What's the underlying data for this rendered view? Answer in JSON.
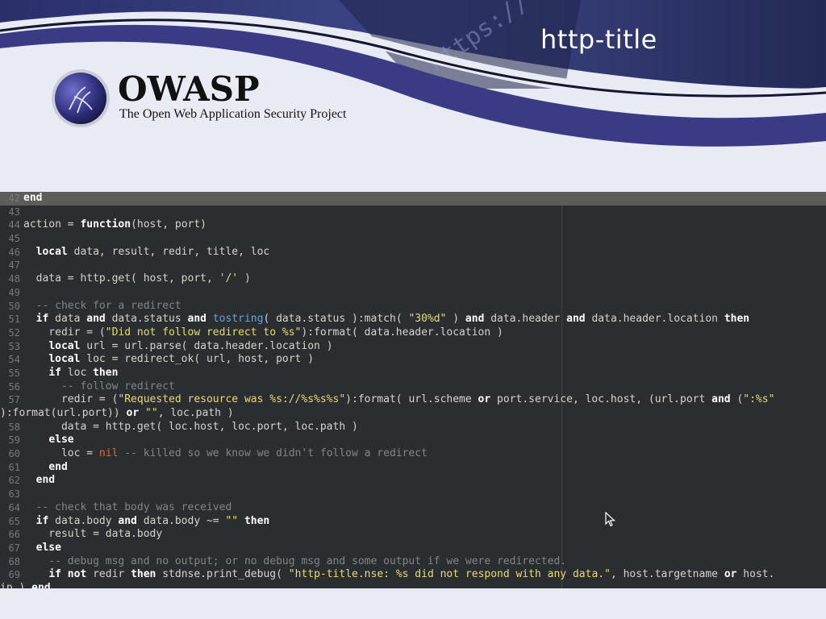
{
  "slide": {
    "title": "http-title"
  },
  "logo": {
    "name": "OWASP",
    "tagline": "The Open Web Application Security Project",
    "banner_text": "https://"
  },
  "colors": {
    "banner": "#3b3a85",
    "code_bg": "#2b2e31",
    "keyword": "#ffffff",
    "string": "#e6db74",
    "comment": "#80848a",
    "builtin": "#66a3d8",
    "nil": "#e66a1a"
  },
  "code": {
    "current_line": 42,
    "lines": [
      {
        "n": "42",
        "t": [
          [
            "k",
            "end"
          ]
        ]
      },
      {
        "n": "43",
        "t": []
      },
      {
        "n": "44",
        "t": [
          [
            "p",
            "action = "
          ],
          [
            "k",
            "function"
          ],
          [
            "p",
            "(host, port)"
          ]
        ]
      },
      {
        "n": "45",
        "t": []
      },
      {
        "n": "46",
        "t": [
          [
            "p",
            "  "
          ],
          [
            "k",
            "local"
          ],
          [
            "p",
            " data, result, redir, title, loc"
          ]
        ]
      },
      {
        "n": "47",
        "t": []
      },
      {
        "n": "48",
        "t": [
          [
            "p",
            "  data = http.get( host, port, "
          ],
          [
            "s",
            "'/'"
          ],
          [
            "p",
            " )"
          ]
        ]
      },
      {
        "n": "49",
        "t": []
      },
      {
        "n": "50",
        "t": [
          [
            "p",
            "  "
          ],
          [
            "c",
            "-- check for a redirect"
          ]
        ]
      },
      {
        "n": "51",
        "t": [
          [
            "p",
            "  "
          ],
          [
            "k",
            "if"
          ],
          [
            "p",
            " data "
          ],
          [
            "k",
            "and"
          ],
          [
            "p",
            " data.status "
          ],
          [
            "k",
            "and"
          ],
          [
            "p",
            " "
          ],
          [
            "f",
            "tostring"
          ],
          [
            "p",
            "( data.status ):match( "
          ],
          [
            "s",
            "\"30%d\""
          ],
          [
            "p",
            " ) "
          ],
          [
            "k",
            "and"
          ],
          [
            "p",
            " data.header "
          ],
          [
            "k",
            "and"
          ],
          [
            "p",
            " data.header.location "
          ],
          [
            "k",
            "then"
          ]
        ]
      },
      {
        "n": "52",
        "t": [
          [
            "p",
            "    redir = ("
          ],
          [
            "s",
            "\"Did not follow redirect to %s\""
          ],
          [
            "p",
            "):format( data.header.location )"
          ]
        ]
      },
      {
        "n": "53",
        "t": [
          [
            "p",
            "    "
          ],
          [
            "k",
            "local"
          ],
          [
            "p",
            " url = url.parse( data.header.location )"
          ]
        ]
      },
      {
        "n": "54",
        "t": [
          [
            "p",
            "    "
          ],
          [
            "k",
            "local"
          ],
          [
            "p",
            " loc = redirect_ok( url, host, port )"
          ]
        ]
      },
      {
        "n": "55",
        "t": [
          [
            "p",
            "    "
          ],
          [
            "k",
            "if"
          ],
          [
            "p",
            " loc "
          ],
          [
            "k",
            "then"
          ]
        ]
      },
      {
        "n": "56",
        "t": [
          [
            "p",
            "      "
          ],
          [
            "c",
            "-- follow redirect"
          ]
        ]
      },
      {
        "n": "57",
        "t": [
          [
            "p",
            "      redir = ("
          ],
          [
            "s",
            "\"Requested resource was %s://%s%s%s\""
          ],
          [
            "p",
            "):format( url.scheme "
          ],
          [
            "k",
            "or"
          ],
          [
            "p",
            " port.service, loc.host, (url.port "
          ],
          [
            "k",
            "and"
          ],
          [
            "p",
            " ("
          ],
          [
            "s",
            "\":%s\""
          ]
        ]
      },
      {
        "n": "",
        "t": [
          [
            "p",
            "):format(url.port)) "
          ],
          [
            "k",
            "or"
          ],
          [
            "p",
            " "
          ],
          [
            "s",
            "\"\""
          ],
          [
            "p",
            ", loc.path )"
          ]
        ]
      },
      {
        "n": "58",
        "t": [
          [
            "p",
            "      data = http.get( loc.host, loc.port, loc.path )"
          ]
        ]
      },
      {
        "n": "59",
        "t": [
          [
            "p",
            "    "
          ],
          [
            "k",
            "else"
          ]
        ]
      },
      {
        "n": "60",
        "t": [
          [
            "p",
            "      loc = "
          ],
          [
            "n",
            "nil"
          ],
          [
            "p",
            " "
          ],
          [
            "c",
            "-- killed so we know we didn't follow a redirect"
          ]
        ]
      },
      {
        "n": "61",
        "t": [
          [
            "p",
            "    "
          ],
          [
            "k",
            "end"
          ]
        ]
      },
      {
        "n": "62",
        "t": [
          [
            "p",
            "  "
          ],
          [
            "k",
            "end"
          ]
        ]
      },
      {
        "n": "63",
        "t": []
      },
      {
        "n": "64",
        "t": [
          [
            "p",
            "  "
          ],
          [
            "c",
            "-- check that body was received"
          ]
        ]
      },
      {
        "n": "65",
        "t": [
          [
            "p",
            "  "
          ],
          [
            "k",
            "if"
          ],
          [
            "p",
            " data.body "
          ],
          [
            "k",
            "and"
          ],
          [
            "p",
            " data.body ~= "
          ],
          [
            "s",
            "\"\""
          ],
          [
            "p",
            " "
          ],
          [
            "k",
            "then"
          ]
        ]
      },
      {
        "n": "66",
        "t": [
          [
            "p",
            "    result = data.body"
          ]
        ]
      },
      {
        "n": "67",
        "t": [
          [
            "p",
            "  "
          ],
          [
            "k",
            "else"
          ]
        ]
      },
      {
        "n": "68",
        "t": [
          [
            "p",
            "    "
          ],
          [
            "c",
            "-- debug msg and no output; or no debug msg and some output if we were redirected."
          ]
        ]
      },
      {
        "n": "69",
        "t": [
          [
            "p",
            "    "
          ],
          [
            "k",
            "if"
          ],
          [
            "p",
            " "
          ],
          [
            "k",
            "not"
          ],
          [
            "p",
            " redir "
          ],
          [
            "k",
            "then"
          ],
          [
            "p",
            " stdnse.print_debug( "
          ],
          [
            "s",
            "\"http-title.nse: %s did not respond with any data.\""
          ],
          [
            "p",
            ", host.targetname "
          ],
          [
            "k",
            "or"
          ],
          [
            "p",
            " host."
          ]
        ]
      },
      {
        "n": "",
        "t": [
          [
            "p",
            "ip ) "
          ],
          [
            "k",
            "end"
          ]
        ]
      }
    ]
  }
}
